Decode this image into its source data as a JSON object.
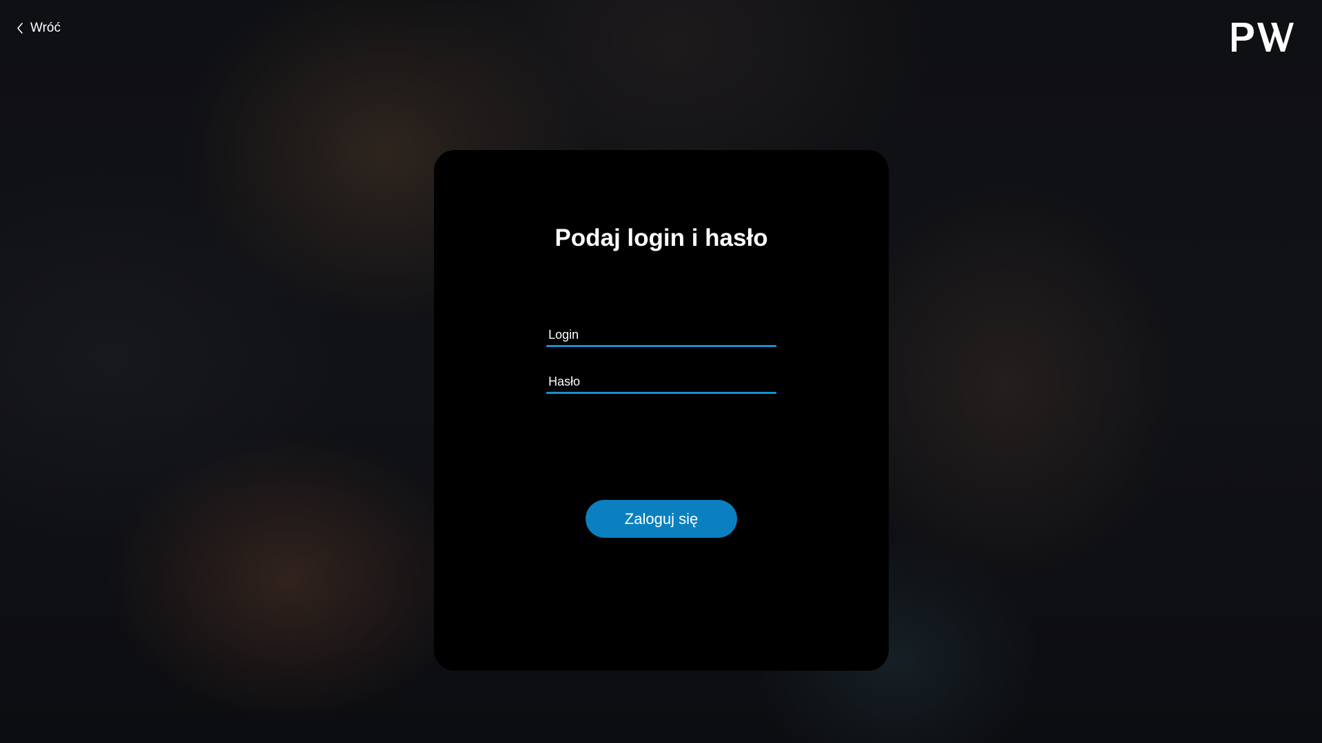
{
  "header": {
    "back_label": "Wróć",
    "back_icon": "chevron-left-icon",
    "logo_text": "PW"
  },
  "login_card": {
    "title": "Podaj login i hasło",
    "login_field": {
      "placeholder": "Login",
      "value": ""
    },
    "password_field": {
      "placeholder": "Hasło",
      "value": ""
    },
    "submit_label": "Zaloguj się"
  },
  "colors": {
    "accent": "#0a80c0",
    "field_underline": "#1a8fcf",
    "card_background": "#000000",
    "text": "#ffffff"
  }
}
